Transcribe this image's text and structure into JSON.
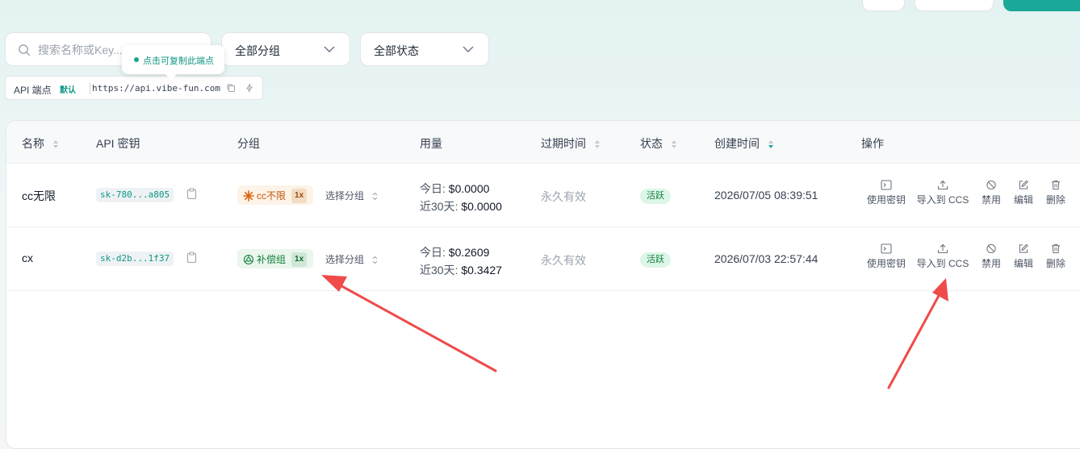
{
  "search": {
    "placeholder": "搜索名称或Key..."
  },
  "filters": {
    "group_selected": "全部分组",
    "status_selected": "全部状态"
  },
  "tooltip": {
    "text": "点击可复制此端点"
  },
  "endpoint": {
    "title": "API 端点",
    "default_badge": "默认",
    "url": "https://api.vibe-fun.com"
  },
  "table": {
    "headers": {
      "name": "名称",
      "api_key": "API 密钥",
      "group": "分组",
      "usage": "用量",
      "expire": "过期时间",
      "status": "状态",
      "created": "创建时间",
      "actions": "操作"
    },
    "rows": [
      {
        "name": "cc无限",
        "key": "sk-780...a805",
        "group_tag": "cc不限",
        "group_mult": "1x",
        "group_color": "#c2580e",
        "choose_label": "选择分组",
        "today_label": "今日:",
        "today_value": "$0.0000",
        "month_label": "近30天:",
        "month_value": "$0.0000",
        "expire": "永久有效",
        "status": "活跃",
        "created": "2026/07/05 08:39:51",
        "actions": {
          "use_key": "使用密钥",
          "import_ccs": "导入到 CCS",
          "disable": "禁用",
          "edit": "编辑",
          "delete": "删除"
        }
      },
      {
        "name": "cx",
        "key": "sk-d2b...1f37",
        "group_tag": "补偿组",
        "group_mult": "1x",
        "group_color": "#15803d",
        "choose_label": "选择分组",
        "today_label": "今日:",
        "today_value": "$0.2609",
        "month_label": "近30天:",
        "month_value": "$0.3427",
        "expire": "永久有效",
        "status": "活跃",
        "created": "2026/07/03 22:57:44",
        "actions": {
          "use_key": "使用密钥",
          "import_ccs": "导入到 CCS",
          "disable": "禁用",
          "edit": "编辑",
          "delete": "删除"
        }
      }
    ]
  },
  "colors": {
    "accent": "#1aa898",
    "annotation_arrow": "#ef4b4b"
  },
  "icons": [
    "search-icon",
    "chevron-down-icon",
    "copy-icon",
    "flash-icon",
    "sort-icon",
    "sort-desc-icon",
    "clipboard-icon",
    "sunburst-icon",
    "openai-icon",
    "terminal-icon",
    "upload-icon",
    "ban-icon",
    "edit-icon",
    "trash-icon"
  ]
}
